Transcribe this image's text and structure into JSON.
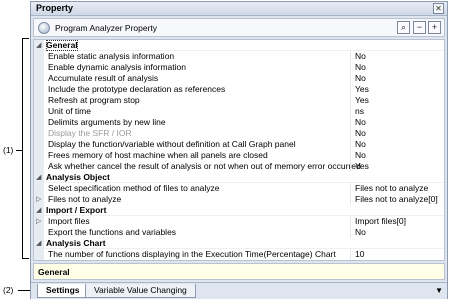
{
  "callouts": {
    "one": "(1)",
    "two": "(2)"
  },
  "window": {
    "title": "Property",
    "close_glyph": "✕"
  },
  "toolbar": {
    "label": "Program Analyzer Property",
    "search_glyph": "⌕",
    "collapse_glyph": "−",
    "expand_glyph": "+"
  },
  "rows": [
    {
      "kind": "cat",
      "name": "General",
      "expander": "◢",
      "selected": true
    },
    {
      "kind": "prop",
      "name": "Enable static analysis information",
      "value": "No"
    },
    {
      "kind": "prop",
      "name": "Enable dynamic analysis information",
      "value": "No"
    },
    {
      "kind": "prop",
      "name": "Accumulate result of analysis",
      "value": "No"
    },
    {
      "kind": "prop",
      "name": "Include the prototype declaration as references",
      "value": "Yes"
    },
    {
      "kind": "prop",
      "name": "Refresh at program stop",
      "value": "Yes"
    },
    {
      "kind": "prop",
      "name": "Unit of time",
      "value": "ns"
    },
    {
      "kind": "prop",
      "name": "Delimits arguments by new line",
      "value": "No"
    },
    {
      "kind": "prop",
      "name": "Display the SFR / IOR",
      "value": "No",
      "disabled": true
    },
    {
      "kind": "prop",
      "name": "Display the function/variable without definition at Call Graph panel",
      "value": "No"
    },
    {
      "kind": "prop",
      "name": "Frees memory of host machine when all panels are closed",
      "value": "No"
    },
    {
      "kind": "prop",
      "name": "Ask whether cancel the result of analysis or not when out of memory error occurred",
      "value": "Yes"
    },
    {
      "kind": "cat",
      "name": "Analysis Object",
      "expander": "◢"
    },
    {
      "kind": "prop",
      "name": "Select specification method of files to analyze",
      "value": "Files not to analyze"
    },
    {
      "kind": "prop",
      "name": "Files not to analyze",
      "value": "Files not to analyze[0]",
      "expander": "▷"
    },
    {
      "kind": "cat",
      "name": "Import / Export",
      "expander": "◢"
    },
    {
      "kind": "prop",
      "name": "Import files",
      "value": "Import files[0]",
      "expander": "▷"
    },
    {
      "kind": "prop",
      "name": "Export the functions and variables",
      "value": "No"
    },
    {
      "kind": "cat",
      "name": "Analysis Chart",
      "expander": "◢"
    },
    {
      "kind": "prop",
      "name": "The number of functions displaying in the Execution Time(Percentage) Chart",
      "value": "10"
    }
  ],
  "description": {
    "title": "General"
  },
  "tabs": [
    {
      "label": "Settings",
      "active": true
    },
    {
      "label": "Variable Value Changing",
      "active": false
    }
  ],
  "tab_dropdown_glyph": "▼"
}
